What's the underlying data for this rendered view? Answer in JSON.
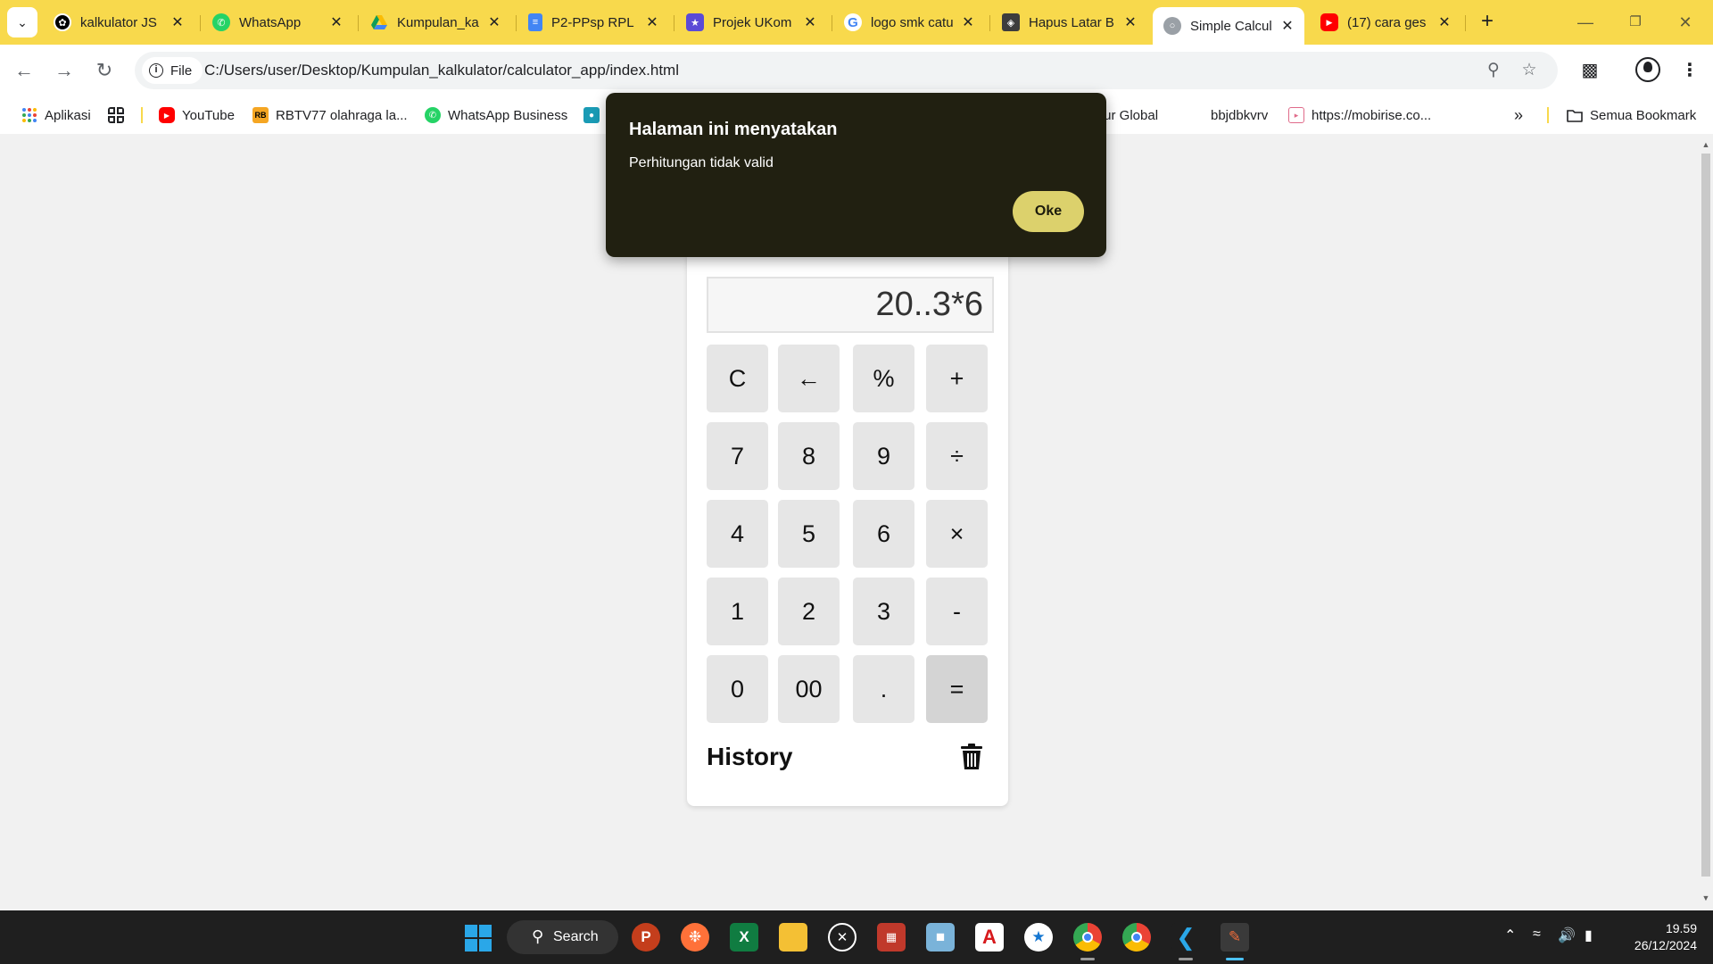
{
  "browser": {
    "tabs": [
      {
        "label": "kalkulator JS",
        "icon": "chatgpt-icon",
        "active": false
      },
      {
        "label": "WhatsApp",
        "icon": "whatsapp-icon",
        "active": false
      },
      {
        "label": "Kumpulan_ka",
        "icon": "google-drive-icon",
        "active": false
      },
      {
        "label": "P2-PPsp RPL",
        "icon": "google-docs-icon",
        "active": false
      },
      {
        "label": "Projek UKom",
        "icon": "certificate-icon",
        "active": false
      },
      {
        "label": "logo smk catu",
        "icon": "google-icon",
        "active": false
      },
      {
        "label": "Hapus Latar B",
        "icon": "remove-bg-icon",
        "active": false
      },
      {
        "label": "Simple Calcul",
        "icon": "globe-icon",
        "active": true
      },
      {
        "label": "(17) cara ges",
        "icon": "youtube-icon",
        "active": false
      }
    ],
    "address": {
      "scheme_label": "File",
      "url": "C:/Users/user/Desktop/Kumpulan_kalkulator/calculator_app/index.html"
    },
    "bookmarks": [
      {
        "label": "Aplikasi",
        "icon": "apps-grid-icon"
      },
      {
        "label": "YouTube",
        "icon": "youtube-icon"
      },
      {
        "label": "RBTV77 olahraga la...",
        "icon": "rb-icon"
      },
      {
        "label": "WhatsApp Business",
        "icon": "whatsapp-icon"
      },
      {
        "label": "tur Global",
        "icon": ""
      },
      {
        "label": "bbjdbkvrv",
        "icon": ""
      },
      {
        "label": "https://mobirise.co...",
        "icon": "mobirise-icon"
      },
      {
        "label": "Semua Bookmark",
        "icon": "folder-icon"
      }
    ]
  },
  "calculator": {
    "display": "20..3*6",
    "keys": [
      [
        "C",
        "←",
        "%",
        "+"
      ],
      [
        "7",
        "8",
        "9",
        "÷"
      ],
      [
        "4",
        "5",
        "6",
        "×"
      ],
      [
        "1",
        "2",
        "3",
        "-"
      ],
      [
        "0",
        "00",
        ".",
        "="
      ]
    ],
    "history_title": "History"
  },
  "dialog": {
    "title": "Halaman ini menyatakan",
    "message": "Perhitungan tidak valid",
    "button": "Oke"
  },
  "taskbar": {
    "search_label": "Search",
    "apps": [
      "powerpoint-icon",
      "firefox-icon",
      "excel-icon",
      "file-explorer-icon",
      "xbox-icon",
      "winrar-icon",
      "photos-icon",
      "acrobat-icon",
      "app-store-icon",
      "chrome-icon",
      "chrome-icon",
      "vscode-icon",
      "paint-icon"
    ],
    "time": "19.59",
    "date": "26/12/2024"
  },
  "colors": {
    "tabstrip": "#f8d94c",
    "dialog_bg": "#212011",
    "dialog_button": "#dcd16c",
    "key_bg": "#e6e6e6",
    "page_bg": "#f1f1f1"
  }
}
